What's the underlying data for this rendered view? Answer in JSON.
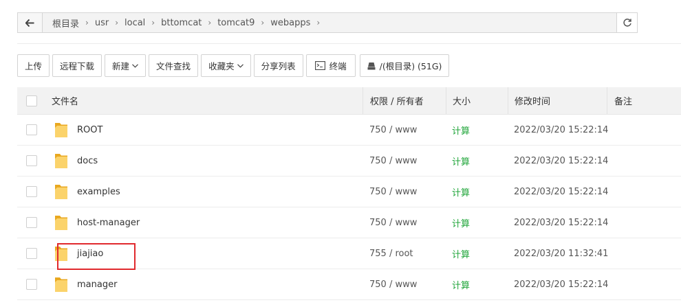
{
  "breadcrumb": [
    "根目录",
    "usr",
    "local",
    "bttomcat",
    "tomcat9",
    "webapps"
  ],
  "toolbar": {
    "upload": "上传",
    "remote_download": "远程下载",
    "new": "新建",
    "find": "文件查找",
    "favorites": "收藏夹",
    "share_list": "分享列表",
    "terminal": "终端",
    "disk": "/(根目录) (51G)"
  },
  "columns": {
    "filename": "文件名",
    "perm": "权限 / 所有者",
    "size": "大小",
    "mtime": "修改时间",
    "note": "备注"
  },
  "rows": [
    {
      "name": "ROOT",
      "perm": "750 / www",
      "size": "计算",
      "mtime": "2022/03/20 15:22:14"
    },
    {
      "name": "docs",
      "perm": "750 / www",
      "size": "计算",
      "mtime": "2022/03/20 15:22:14"
    },
    {
      "name": "examples",
      "perm": "750 / www",
      "size": "计算",
      "mtime": "2022/03/20 15:22:14"
    },
    {
      "name": "host-manager",
      "perm": "750 / www",
      "size": "计算",
      "mtime": "2022/03/20 15:22:14"
    },
    {
      "name": "jiajiao",
      "perm": "755 / root",
      "size": "计算",
      "mtime": "2022/03/20 11:32:41"
    },
    {
      "name": "manager",
      "perm": "750 / www",
      "size": "计算",
      "mtime": "2022/03/20 15:22:14"
    }
  ],
  "colors": {
    "accent_green": "#20a53a",
    "highlight_red": "#e0282c",
    "folder_yellow": "#f5c542"
  },
  "icons": {
    "back": "arrow-left-icon",
    "refresh": "refresh-icon",
    "terminal": "terminal-icon",
    "disk": "disk-icon",
    "folder": "folder-icon"
  }
}
